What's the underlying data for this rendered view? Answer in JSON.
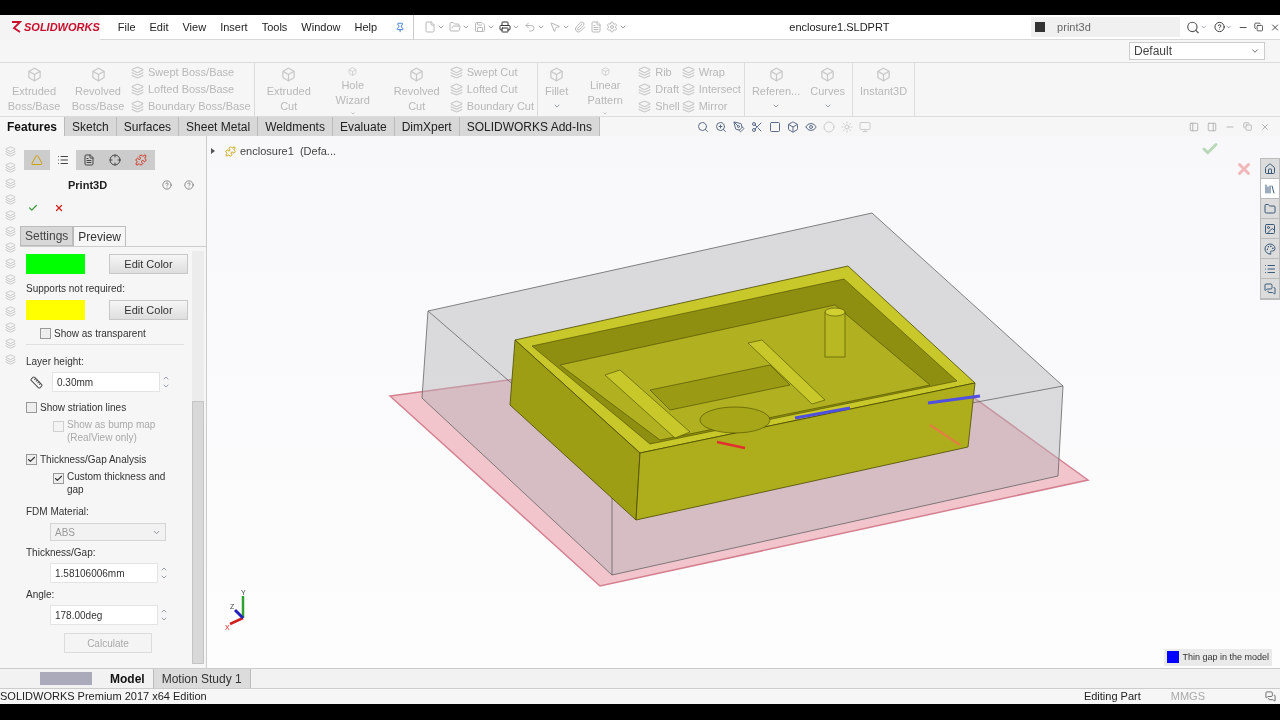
{
  "title_bar": {
    "logo": "SOLIDWORKS",
    "menus": [
      "File",
      "Edit",
      "View",
      "Insert",
      "Tools",
      "Window",
      "Help"
    ],
    "document_title": "enclosure1.SLDPRT",
    "search": {
      "value": "print3d"
    }
  },
  "configuration": {
    "value": "Default"
  },
  "command_groups": [
    [
      {
        "kind": "large",
        "label": "Extruded Boss/Base",
        "caret": false
      },
      {
        "kind": "large",
        "label": "Revolved Boss/Base",
        "caret": false
      },
      {
        "kind": "stack",
        "items": [
          "Swept Boss/Base",
          "Lofted Boss/Base",
          "Boundary Boss/Base"
        ]
      }
    ],
    [
      {
        "kind": "large",
        "label": "Extruded Cut",
        "caret": false
      },
      {
        "kind": "large",
        "label": "Hole Wizard",
        "caret": true
      },
      {
        "kind": "large",
        "label": "Revolved Cut",
        "caret": false
      },
      {
        "kind": "stack",
        "items": [
          "Swept Cut",
          "Lofted Cut",
          "Boundary Cut"
        ]
      }
    ],
    [
      {
        "kind": "large",
        "label": "Fillet",
        "caret": true
      },
      {
        "kind": "large",
        "label": "Linear Pattern",
        "caret": true
      },
      {
        "kind": "stack",
        "items": [
          "Rib",
          "Draft",
          "Shell"
        ]
      },
      {
        "kind": "stack",
        "items": [
          "Wrap",
          "Intersect",
          "Mirror"
        ]
      }
    ],
    [
      {
        "kind": "large",
        "label": "Referen...",
        "caret": true
      },
      {
        "kind": "large",
        "label": "Curves",
        "caret": true
      }
    ],
    [
      {
        "kind": "large",
        "label": "Instant3D",
        "caret": false
      }
    ]
  ],
  "command_tabs": [
    {
      "label": "Features",
      "selected": true
    },
    {
      "label": "Sketch",
      "selected": false
    },
    {
      "label": "Surfaces",
      "selected": false
    },
    {
      "label": "Sheet Metal",
      "selected": false
    },
    {
      "label": "Weldments",
      "selected": false
    },
    {
      "label": "Evaluate",
      "selected": false
    },
    {
      "label": "DimXpert",
      "selected": false
    },
    {
      "label": "SOLIDWORKS Add-Ins",
      "selected": false
    }
  ],
  "feature_tree": {
    "root": "enclosure1  (Defa..."
  },
  "property_manager": {
    "title": "Print3D",
    "tabs": [
      {
        "label": "Settings",
        "selected": false
      },
      {
        "label": "Preview",
        "selected": true
      }
    ],
    "rows": [
      {
        "kind": "swatch",
        "color": "#00ff00",
        "button": "Edit Color"
      },
      {
        "kind": "label",
        "text": "Supports not required:"
      },
      {
        "kind": "swatch",
        "color": "#ffff00",
        "button": "Edit Color"
      },
      {
        "kind": "option",
        "label": "Show as transparent",
        "checked": false
      },
      {
        "kind": "label",
        "text": "Layer height:"
      },
      {
        "kind": "layer_spin",
        "value": "0.30mm"
      },
      {
        "kind": "checkbox",
        "label": "Show striation lines",
        "checked": false,
        "disabled": false,
        "children": [
          {
            "label": "Show as bump map (RealView only)",
            "checked": false,
            "disabled": true
          }
        ]
      },
      {
        "kind": "checkbox",
        "label": "Thickness/Gap Analysis",
        "checked": true,
        "disabled": false,
        "children": [
          {
            "label": "Custom thickness and gap",
            "checked": true,
            "disabled": false
          }
        ]
      },
      {
        "kind": "label",
        "text": "FDM Material:"
      },
      {
        "kind": "select",
        "value": "ABS",
        "disabled": true
      },
      {
        "kind": "label",
        "text": "Thickness/Gap:"
      },
      {
        "kind": "spin",
        "value": "1.58106006mm"
      },
      {
        "kind": "label",
        "text": "Angle:"
      },
      {
        "kind": "spin",
        "value": "178.00deg"
      },
      {
        "kind": "button",
        "label": "Calculate",
        "disabled": true
      }
    ]
  },
  "triad": {
    "x": "X",
    "y": "Y",
    "z": "Z"
  },
  "legend": [
    {
      "label": "Thin gap in the model",
      "color": "#0000ff"
    }
  ],
  "document_tabs": [
    {
      "label": "Model",
      "selected": true
    },
    {
      "label": "Motion Study 1",
      "selected": false
    }
  ],
  "status_bar": {
    "product": "SOLIDWORKS Premium 2017 x64 Edition",
    "mode": "Editing Part",
    "units": "MMGS"
  }
}
